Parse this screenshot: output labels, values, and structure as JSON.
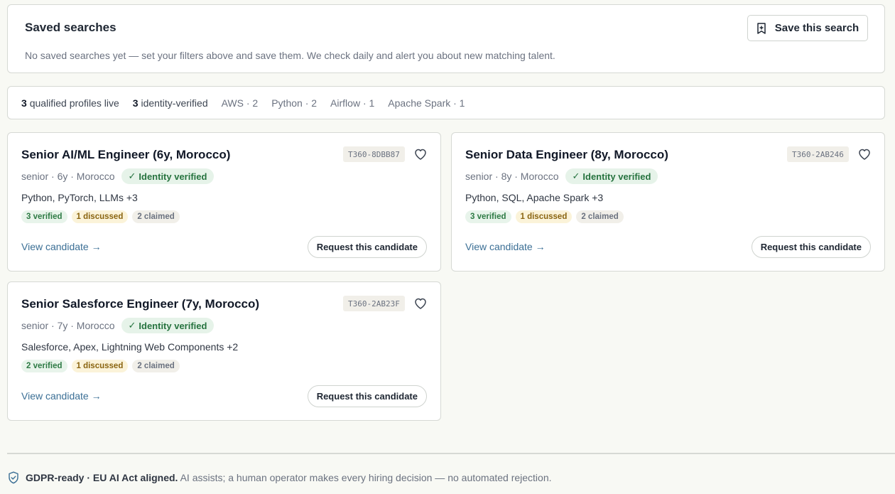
{
  "saved_searches": {
    "title": "Saved searches",
    "description": "No saved searches yet — set your filters above and save them. We check daily and alert you about new matching talent.",
    "save_button": "Save this search"
  },
  "stats": {
    "qualified_count": "3",
    "qualified_label": "qualified profiles live",
    "verified_count": "3",
    "verified_label": "identity-verified",
    "tags": [
      "AWS · 2",
      "Python · 2",
      "Airflow · 1",
      "Apache Spark · 1"
    ]
  },
  "cards": [
    {
      "title": "Senior AI/ML Engineer (6y, Morocco)",
      "id": "T360-8DBB87",
      "meta": "senior · 6y · Morocco",
      "badge": "Identity verified",
      "skills": "Python, PyTorch, LLMs +3",
      "verified": "3 verified",
      "discussed": "1 discussed",
      "claimed": "2 claimed",
      "view": "View candidate →",
      "request": "Request this candidate"
    },
    {
      "title": "Senior Data Engineer (8y, Morocco)",
      "id": "T360-2AB246",
      "meta": "senior · 8y · Morocco",
      "badge": "Identity verified",
      "skills": "Python, SQL, Apache Spark +3",
      "verified": "3 verified",
      "discussed": "1 discussed",
      "claimed": "2 claimed",
      "view": "View candidate →",
      "request": "Request this candidate"
    },
    {
      "title": "Senior Salesforce Engineer (7y, Morocco)",
      "id": "T360-2AB23F",
      "meta": "senior · 7y · Morocco",
      "badge": "Identity verified",
      "skills": "Salesforce, Apex, Lightning Web Components +2",
      "verified": "2 verified",
      "discussed": "1 discussed",
      "claimed": "2 claimed",
      "view": "View candidate →",
      "request": "Request this candidate"
    }
  ],
  "footer": {
    "strong": "GDPR-ready · EU AI Act aligned.",
    "text": "AI assists; a human operator makes every hiring decision — no automated rejection."
  },
  "icons": {
    "save": "bookmark-plus-icon",
    "favorite": "heart-icon",
    "check": "check-icon",
    "footer": "shield-check-icon"
  },
  "colors": {
    "verified_green": "#26733f",
    "link_blue": "#3b6f95",
    "discussed_amber": "#8a6410"
  }
}
